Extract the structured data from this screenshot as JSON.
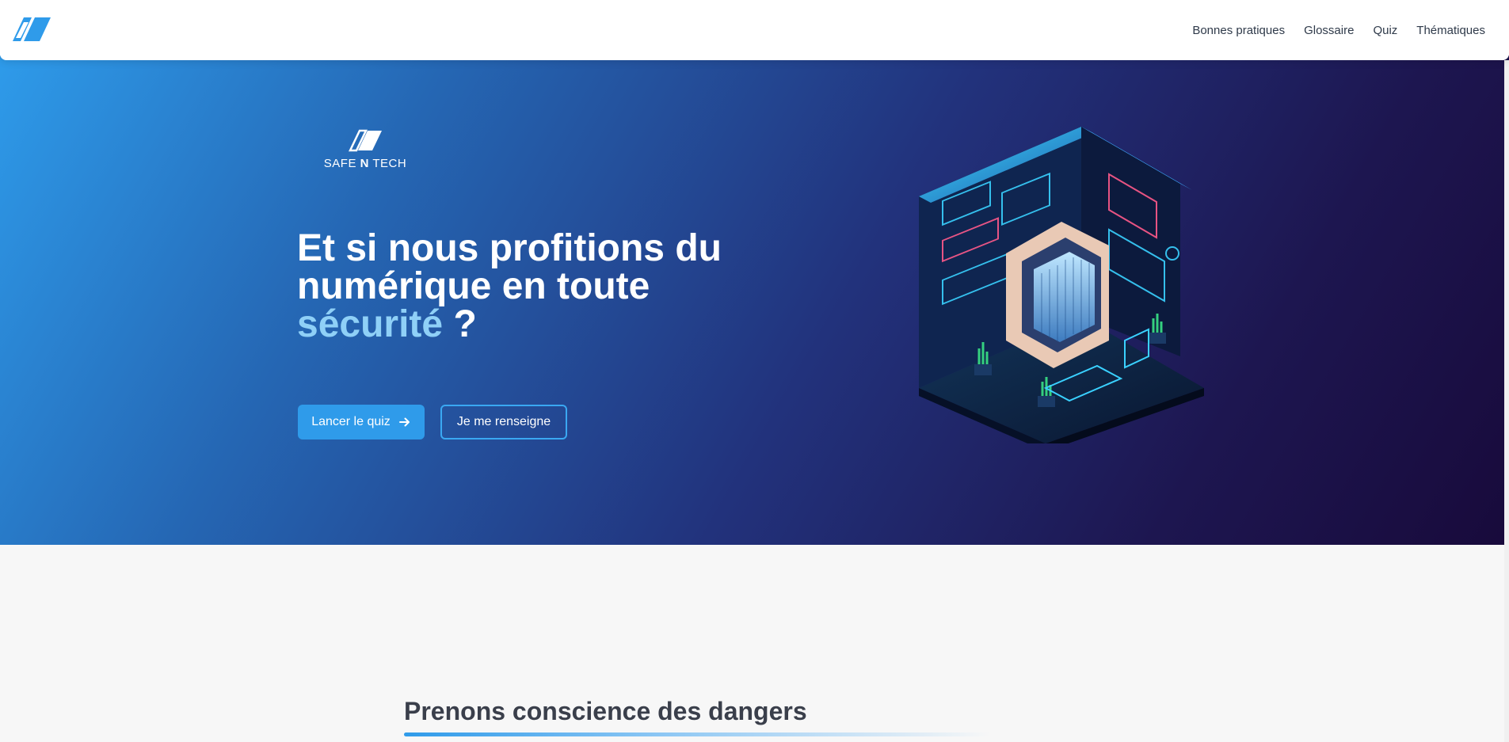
{
  "header": {
    "logo_icon": "safe-n-tech-logo-icon",
    "nav": [
      {
        "label": "Bonnes pratiques"
      },
      {
        "label": "Glossaire"
      },
      {
        "label": "Quiz"
      },
      {
        "label": "Thématiques"
      }
    ]
  },
  "hero": {
    "brand": {
      "part1": "SAFE ",
      "part2": "N",
      "part3": " TECH"
    },
    "headline": {
      "line1": "Et si nous profitions du",
      "line2": "numérique en toute",
      "accent": "sécurité",
      "suffix": " ?"
    },
    "primary_button": {
      "label": "Lancer le quiz",
      "icon": "arrow-right-icon"
    },
    "secondary_button": {
      "label": "Je me renseigne"
    },
    "illustration": "isometric-server-room-illustration"
  },
  "section": {
    "title": "Prenons conscience des dangers"
  },
  "colors": {
    "accent_blue": "#2f9bea",
    "accent_light": "#8fd0f7",
    "hero_dark": "#180a3b",
    "text_dark": "#3a3f4b"
  }
}
